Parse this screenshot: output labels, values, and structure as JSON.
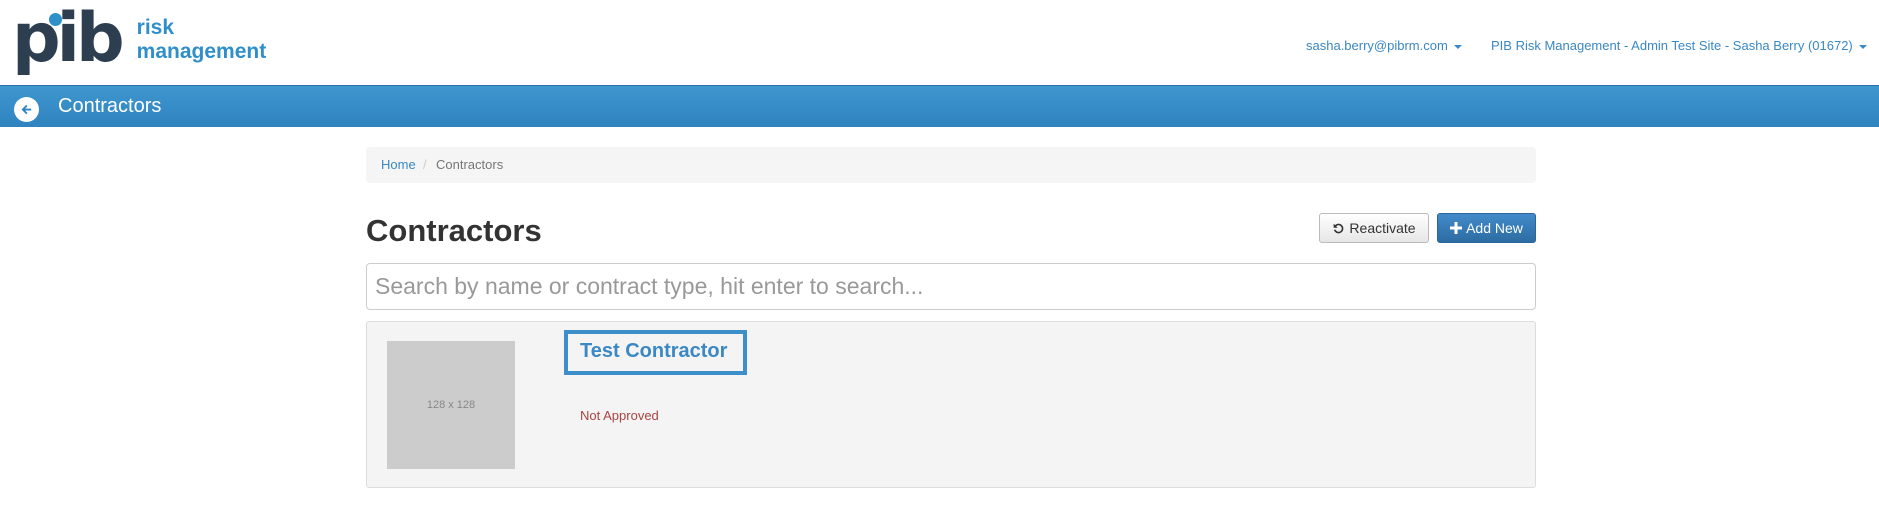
{
  "header": {
    "logo_mark": "pib",
    "logo_line1": "risk",
    "logo_line2": "management",
    "user_email": "sasha.berry@pibrm.com",
    "site_selector": "PIB Risk Management - Admin Test Site - Sasha Berry (01672)"
  },
  "titlebar": {
    "title": "Contractors"
  },
  "breadcrumb": {
    "home": "Home",
    "separator": "/",
    "current": "Contractors"
  },
  "page": {
    "title": "Contractors",
    "reactivate_label": "Reactivate",
    "add_new_label": "Add New",
    "search_placeholder": "Search by name or contract type, hit enter to search..."
  },
  "contractors": [
    {
      "thumbnail_text": "128 x 128",
      "name": "Test Contractor",
      "status": "Not Approved"
    }
  ],
  "colors": {
    "brand_blue": "#2f8fc9",
    "primary_button": "#428bca",
    "status_danger": "#a94442"
  }
}
